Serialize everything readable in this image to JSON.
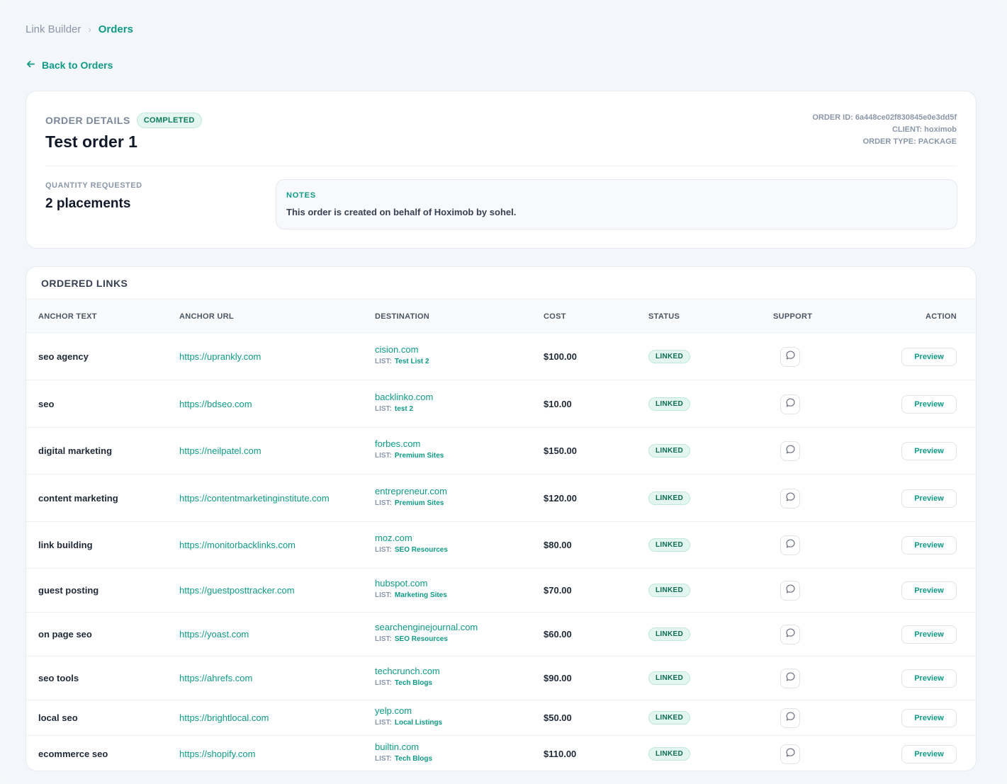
{
  "breadcrumb": {
    "parent": "Link Builder",
    "separator": "›",
    "current": "Orders"
  },
  "back_link": "Back to Orders",
  "order": {
    "section_label": "ORDER DETAILS",
    "status": "COMPLETED",
    "title": "Test order 1",
    "order_id": "ORDER ID: 6a448ce02f830845e0e3dd5f",
    "client": "CLIENT: hoximob",
    "order_type": "ORDER TYPE: PACKAGE",
    "quantity_label": "QUANTITY REQUESTED",
    "quantity_value": "2 placements",
    "notes_label": "NOTES",
    "notes_text": "This order is created on behalf of Hoximob by sohel."
  },
  "links": {
    "title": "ORDERED LINKS",
    "columns": [
      "ANCHOR TEXT",
      "ANCHOR URL",
      "DESTINATION",
      "COST",
      "STATUS",
      "SUPPORT",
      "ACTION"
    ],
    "list_label": "LIST:",
    "preview_label": "Preview",
    "rows": [
      {
        "anchor_text": "seo agency",
        "anchor_url": "https://uprankly.com",
        "destination": "cision.com",
        "list": "Test List 2",
        "cost": "$100.00",
        "status": "LINKED"
      },
      {
        "anchor_text": "seo",
        "anchor_url": "https://bdseo.com",
        "destination": "backlinko.com",
        "list": "test 2",
        "cost": "$10.00",
        "status": "LINKED"
      },
      {
        "anchor_text": "digital marketing",
        "anchor_url": "https://neilpatel.com",
        "destination": "forbes.com",
        "list": "Premium Sites",
        "cost": "$150.00",
        "status": "LINKED"
      },
      {
        "anchor_text": "content marketing",
        "anchor_url": "https://contentmarketinginstitute.com",
        "destination": "entrepreneur.com",
        "list": "Premium Sites",
        "cost": "$120.00",
        "status": "LINKED"
      },
      {
        "anchor_text": "link building",
        "anchor_url": "https://monitorbacklinks.com",
        "destination": "moz.com",
        "list": "SEO Resources",
        "cost": "$80.00",
        "status": "LINKED"
      },
      {
        "anchor_text": "guest posting",
        "anchor_url": "https://guestposttracker.com",
        "destination": "hubspot.com",
        "list": "Marketing Sites",
        "cost": "$70.00",
        "status": "LINKED"
      },
      {
        "anchor_text": "on page seo",
        "anchor_url": "https://yoast.com",
        "destination": "searchenginejournal.com",
        "list": "SEO Resources",
        "cost": "$60.00",
        "status": "LINKED"
      },
      {
        "anchor_text": "seo tools",
        "anchor_url": "https://ahrefs.com",
        "destination": "techcrunch.com",
        "list": "Tech Blogs",
        "cost": "$90.00",
        "status": "LINKED"
      },
      {
        "anchor_text": "local seo",
        "anchor_url": "https://brightlocal.com",
        "destination": "yelp.com",
        "list": "Local Listings",
        "cost": "$50.00",
        "status": "LINKED"
      },
      {
        "anchor_text": "ecommerce seo",
        "anchor_url": "https://shopify.com",
        "destination": "builtin.com",
        "list": "Tech Blogs",
        "cost": "$110.00",
        "status": "LINKED"
      }
    ]
  }
}
